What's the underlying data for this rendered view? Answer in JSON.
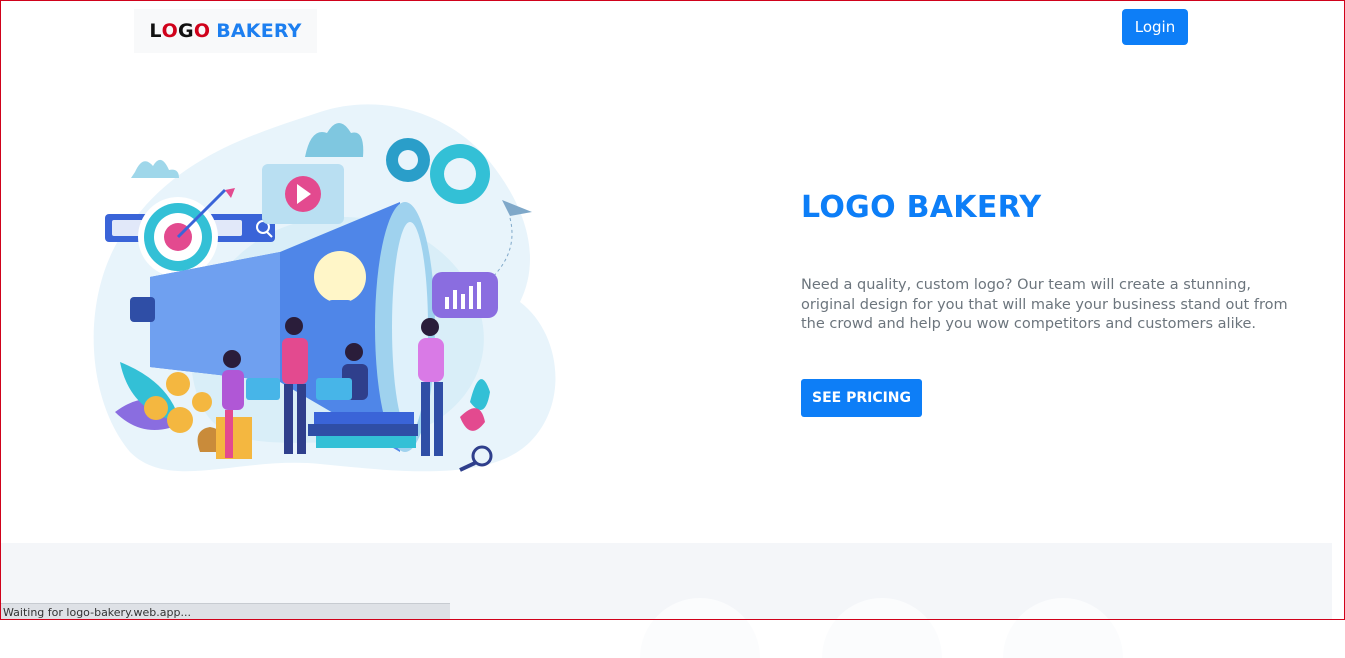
{
  "nav": {
    "brand": {
      "l1": "L",
      "l2": "O",
      "l3": "G",
      "l4": "O",
      "rest": "BAKERY"
    },
    "login_label": "Login"
  },
  "hero": {
    "title": "LOGO BAKERY",
    "description": "Need a quality, custom logo? Our team will create a stunning, original design for you that will make your business stand out from the crowd and help you wow competitors and customers alike.",
    "cta_label": "SEE PRICING"
  },
  "status_bar": {
    "text": "Waiting for logo-bakery.web.app..."
  },
  "colors": {
    "primary": "#0d7ef7",
    "logo_red": "#d0021b",
    "text_muted": "#6c757d"
  },
  "icons": [
    "megaphone-illustration",
    "gear-icon",
    "play-icon",
    "search-icon",
    "target-icon",
    "lightbulb-icon",
    "chart-bubble-icon",
    "paper-plane-icon",
    "magnifier-icon",
    "money-bag-icon"
  ]
}
